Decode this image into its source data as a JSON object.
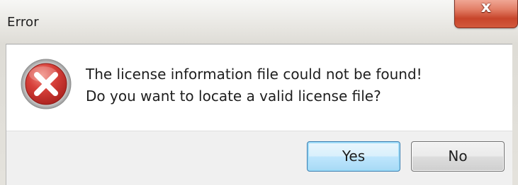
{
  "window": {
    "title": "Error",
    "close_glyph": "x"
  },
  "message": {
    "line1": "The license information file could not be found!",
    "line2": "Do you want to locate a valid license file?",
    "icon": "error-icon"
  },
  "buttons": {
    "yes_label": "Yes",
    "no_label": "No",
    "default": "yes"
  },
  "colors": {
    "error_icon": "#c9302c",
    "close_button": "#c8452b",
    "default_button_border": "#3c7fb1"
  }
}
